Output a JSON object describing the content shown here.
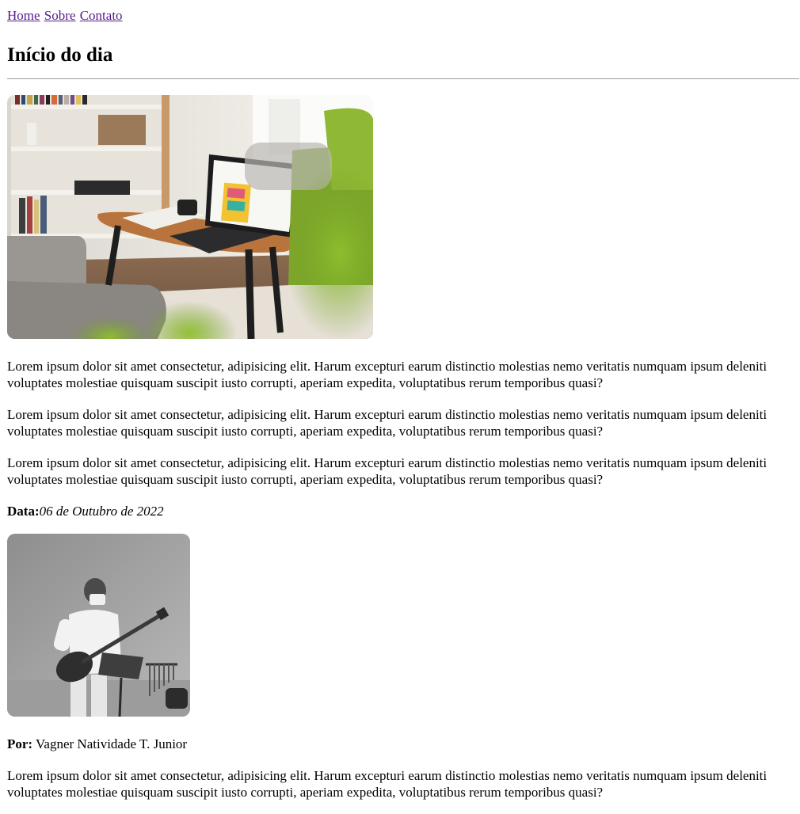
{
  "nav": {
    "links": [
      "Home",
      "Sobre",
      "Contato"
    ]
  },
  "title": "Início do dia",
  "paragraphs": [
    "Lorem ipsum dolor sit amet consectetur, adipisicing elit. Harum excepturi earum distinctio molestias nemo veritatis numquam ipsum deleniti voluptates molestiae quisquam suscipit iusto corrupti, aperiam expedita, voluptatibus rerum temporibus quasi?",
    "Lorem ipsum dolor sit amet consectetur, adipisicing elit. Harum excepturi earum distinctio molestias nemo veritatis numquam ipsum deleniti voluptates molestiae quisquam suscipit iusto corrupti, aperiam expedita, voluptatibus rerum temporibus quasi?",
    "Lorem ipsum dolor sit amet consectetur, adipisicing elit. Harum excepturi earum distinctio molestias nemo veritatis numquam ipsum deleniti voluptates molestiae quisquam suscipit iusto corrupti, aperiam expedita, voluptatibus rerum temporibus quasi?",
    "Lorem ipsum dolor sit amet consectetur, adipisicing elit. Harum excepturi earum distinctio molestias nemo veritatis numquam ipsum deleniti voluptates molestiae quisquam suscipit iusto corrupti, aperiam expedita, voluptatibus rerum temporibus quasi?"
  ],
  "date": {
    "label": "Data:",
    "value": "06 de Outubro de 2022"
  },
  "author": {
    "label": "Por:",
    "name": " Vagner Natividade T. Junior"
  },
  "colors": {
    "link": "#551a8b",
    "rule": "#999999"
  }
}
